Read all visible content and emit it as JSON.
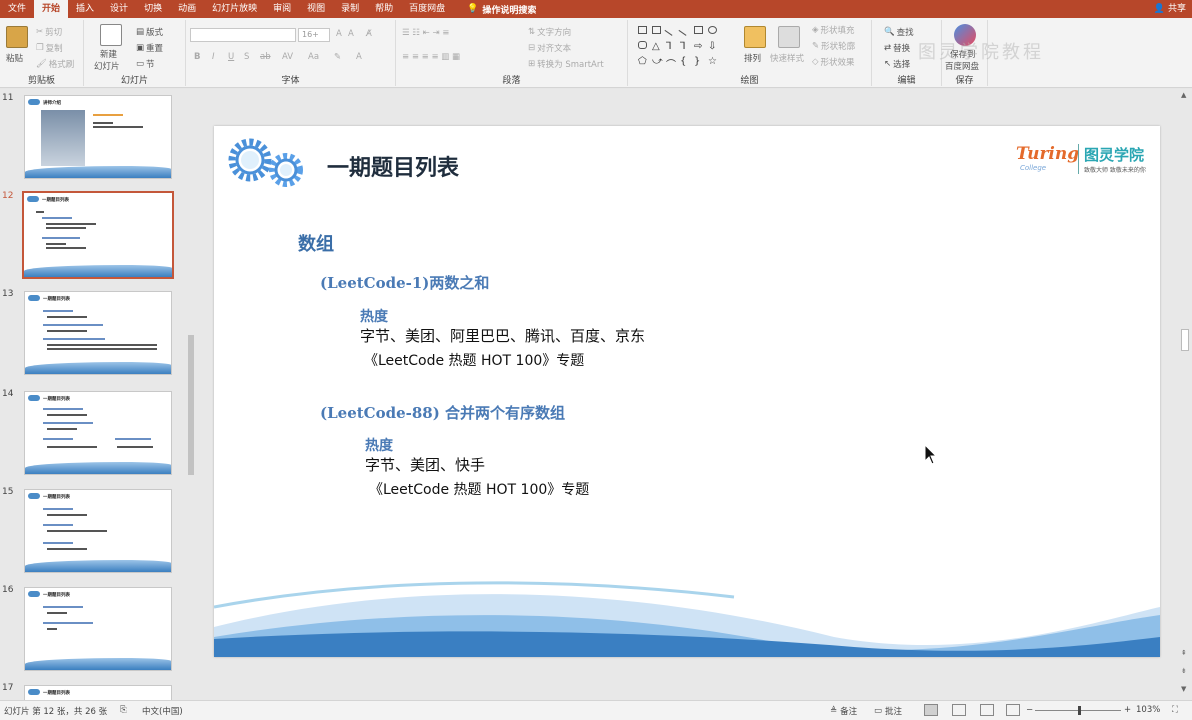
{
  "tabs": [
    "文件",
    "开始",
    "插入",
    "设计",
    "切换",
    "动画",
    "幻灯片放映",
    "审阅",
    "视图",
    "录制",
    "帮助",
    "百度网盘"
  ],
  "active_tab": "开始",
  "tell_me": "操作说明搜索",
  "share": "共享",
  "ribbon": {
    "clipboard": {
      "paste": "粘贴",
      "cut": "剪切",
      "copy": "复制",
      "format_painter": "格式刷",
      "label": "剪贴板"
    },
    "slides": {
      "new_slide": "新建",
      "new_slide2": "幻灯片",
      "layout": "版式",
      "reset": "重置",
      "section": "节",
      "label": "幻灯片"
    },
    "font": {
      "size": "16+",
      "label": "字体",
      "format": [
        "B",
        "I",
        "U",
        "S",
        "ab",
        "AV",
        "Aa",
        "A",
        "A"
      ]
    },
    "paragraph": {
      "text_direction": "文字方向",
      "align_text": "对齐文本",
      "smartart": "转换为 SmartArt",
      "label": "段落"
    },
    "drawing": {
      "arrange": "排列",
      "quick_styles": "快速样式",
      "fill": "形状填充",
      "outline": "形状轮廓",
      "effects": "形状效果",
      "label": "绘图"
    },
    "editing": {
      "find": "查找",
      "replace": "替换",
      "select": "选择",
      "label": "编辑"
    },
    "save": {
      "save_to": "保存到",
      "baidu": "百度网盘",
      "label": "保存"
    }
  },
  "watermark": "图灵学院教程",
  "thumbnails": [
    {
      "num": "11",
      "title": "讲师介绍"
    },
    {
      "num": "12",
      "title": "一期题目列表"
    },
    {
      "num": "13",
      "title": "一期题目列表"
    },
    {
      "num": "14",
      "title": "一期题目列表"
    },
    {
      "num": "15",
      "title": "一期题目列表"
    },
    {
      "num": "16",
      "title": "一期题目列表"
    },
    {
      "num": "17",
      "title": "一期题目列表"
    }
  ],
  "slide": {
    "title": "一期题目列表",
    "logo": {
      "turing": "Turing",
      "college": "College",
      "name": "图灵学院",
      "slogan": "致敬大师 致敬未来的你"
    },
    "section": "数组",
    "problems": [
      {
        "title": "(LeetCode-1)两数之和",
        "heat_label": "热度",
        "companies": "字节、美团、阿里巴巴、腾讯、百度、京东",
        "topic": "《LeetCode 热题 HOT 100》专题"
      },
      {
        "title": "(LeetCode-88) 合并两个有序数组",
        "heat_label": "热度",
        "companies": "字节、美团、快手",
        "topic": "《LeetCode 热题 HOT 100》专题"
      }
    ]
  },
  "status": {
    "slide_info": "幻灯片 第 12 张，共 26 张",
    "language": "中文(中国)",
    "notes": "备注",
    "comments": "批注",
    "zoom": "103%"
  }
}
